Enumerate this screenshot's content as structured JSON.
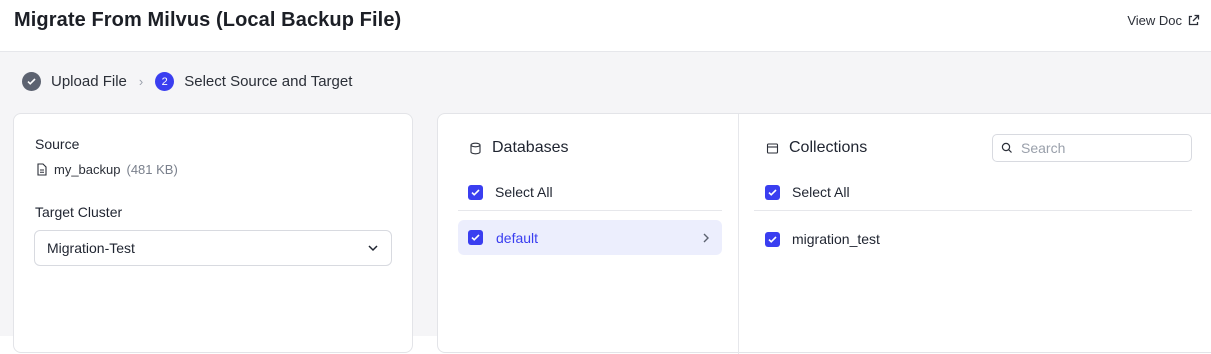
{
  "header": {
    "title": "Migrate From Milvus (Local Backup File)",
    "view_doc_label": "View Doc"
  },
  "stepper": {
    "steps": [
      {
        "label": "Upload File",
        "state": "done"
      },
      {
        "label": "Select Source and Target",
        "state": "active",
        "number": "2"
      }
    ]
  },
  "source_panel": {
    "source_label": "Source",
    "file_name": "my_backup",
    "file_size": "(481 KB)",
    "target_cluster_label": "Target Cluster",
    "target_cluster_value": "Migration-Test"
  },
  "databases": {
    "title": "Databases",
    "select_all_label": "Select All",
    "select_all_checked": true,
    "items": [
      {
        "name": "default",
        "checked": true,
        "selected": true
      }
    ]
  },
  "collections": {
    "title": "Collections",
    "search_placeholder": "Search",
    "select_all_label": "Select All",
    "select_all_checked": true,
    "items": [
      {
        "name": "migration_test",
        "checked": true
      }
    ]
  },
  "colors": {
    "accent": "#3a3ef0",
    "selected_row_bg": "#eceefd",
    "page_bg": "#f5f5f7"
  }
}
